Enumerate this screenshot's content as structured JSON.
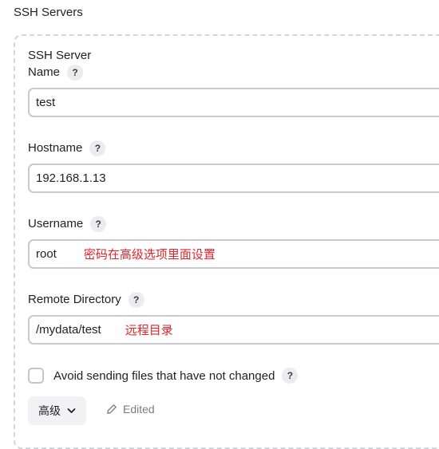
{
  "section": {
    "title": "SSH Servers"
  },
  "server": {
    "title": "SSH Server",
    "help_glyph": "?",
    "name": {
      "label": "Name",
      "value": "test"
    },
    "hostname": {
      "label": "Hostname",
      "value": "192.168.1.13"
    },
    "username": {
      "label": "Username",
      "value": "root",
      "note": "密码在高级选项里面设置"
    },
    "remote_directory": {
      "label": "Remote Directory",
      "value": "/mydata/test",
      "note": "远程目录"
    },
    "avoid_sending": {
      "label": "Avoid sending files that have not changed",
      "checked": false
    },
    "advanced_button": {
      "label": "高级",
      "icon": "chevron-down-icon"
    },
    "edited_status": {
      "label": "Edited",
      "icon": "pencil-icon"
    }
  },
  "colors": {
    "note": "#e0262b",
    "border": "#c8cad1",
    "dashed": "#d4d6dc"
  }
}
